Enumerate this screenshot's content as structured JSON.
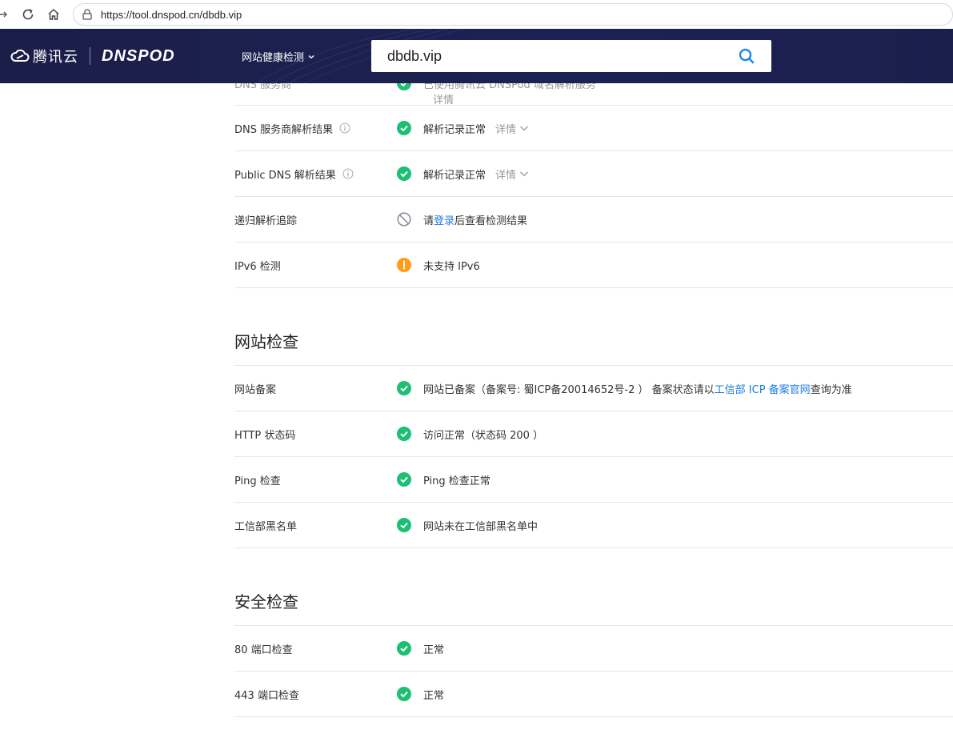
{
  "browser": {
    "url": "https://tool.dnspod.cn/dbdb.vip"
  },
  "header": {
    "brand_cn": "腾讯云",
    "brand_en": "DNSPOD",
    "nav_label": "网站健康检测",
    "search_value": "dbdb.vip"
  },
  "dns_section": {
    "partial_row": {
      "label": "DNS 服务商",
      "value": "已使用腾讯云 DNSPod 域名解析服务",
      "detail": "详情"
    },
    "rows": [
      {
        "label": "DNS 服务商解析结果",
        "value": "解析记录正常",
        "detail": "详情",
        "status": "ok"
      },
      {
        "label": "Public DNS 解析结果",
        "value": "解析记录正常",
        "detail": "详情",
        "status": "ok"
      },
      {
        "label": "递归解析追踪",
        "value_prefix": "请",
        "value_link": "登录",
        "value_suffix": "后查看检测结果",
        "status": "disabled"
      },
      {
        "label": "IPv6 检测",
        "value": "未支持 IPv6",
        "status": "warning"
      }
    ]
  },
  "site_section": {
    "title": "网站检查",
    "rows": [
      {
        "label": "网站备案",
        "value_prefix": "网站已备案（备案号: 蜀ICP备20014652号-2 ） 备案状态请以",
        "value_link": "工信部 ICP 备案官网",
        "value_suffix": " 查询为准",
        "status": "ok"
      },
      {
        "label": "HTTP 状态码",
        "value": "访问正常（状态码 200 ）",
        "status": "ok"
      },
      {
        "label": "Ping 检查",
        "value": "Ping 检查正常",
        "status": "ok"
      },
      {
        "label": "工信部黑名单",
        "value": "网站未在工信部黑名单中",
        "status": "ok"
      }
    ]
  },
  "security_section": {
    "title": "安全检查",
    "rows": [
      {
        "label": "80 端口检查",
        "value": "正常",
        "status": "ok"
      },
      {
        "label": "443 端口检查",
        "value": "正常",
        "status": "ok"
      }
    ]
  },
  "colors": {
    "header_bg": "#1b1e48",
    "ok": "#1dbf73",
    "warning": "#ff9c19",
    "link": "#1e7be2",
    "search_icon": "#1e88e5"
  }
}
